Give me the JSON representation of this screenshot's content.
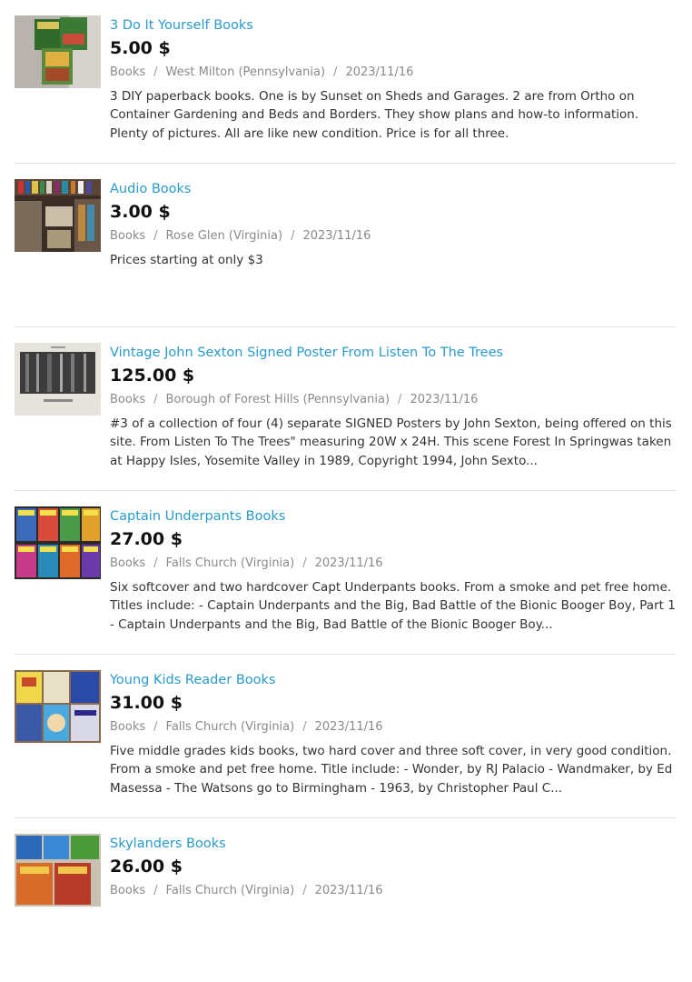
{
  "listings": [
    {
      "title": "3 Do It Yourself Books",
      "price": "5.00 $",
      "category": "Books",
      "separator": "/",
      "location": "West Milton (Pennsylvania)",
      "date": "2023/11/16",
      "description": "3 DIY paperback books. One is by Sunset on Sheds and Garages. 2 are from Ortho on Container Gardening and Beds and Borders. They show plans and how-to information. Plenty of pictures. All are like new condition. Price is for all three."
    },
    {
      "title": "Audio Books",
      "price": "3.00 $",
      "category": "Books",
      "separator": "/",
      "location": "Rose Glen (Virginia)",
      "date": "2023/11/16",
      "description": "Prices starting at only $3"
    },
    {
      "title": "Vintage John Sexton Signed Poster From Listen To The Trees",
      "price": "125.00 $",
      "category": "Books",
      "separator": "/",
      "location": "Borough of Forest Hills (Pennsylvania)",
      "date": "2023/11/16",
      "description": "#3 of a collection of four (4) separate SIGNED Posters by John Sexton, being offered on this site. From Listen To The Trees\" measuring 20W x 24H. This scene Forest In Springwas taken at Happy Isles, Yosemite Valley in 1989, Copyright 1994, John Sexto..."
    },
    {
      "title": "Captain Underpants Books",
      "price": "27.00 $",
      "category": "Books",
      "separator": "/",
      "location": "Falls Church (Virginia)",
      "date": "2023/11/16",
      "description": "Six softcover and two hardcover Capt Underpants books. From a smoke and pet free home. Titles include: - Captain Underpants and the Big, Bad Battle of the Bionic Booger Boy, Part 1 - Captain Underpants and the Big, Bad Battle of the Bionic Booger Boy..."
    },
    {
      "title": "Young Kids Reader Books",
      "price": "31.00 $",
      "category": "Books",
      "separator": "/",
      "location": "Falls Church (Virginia)",
      "date": "2023/11/16",
      "description": "Five middle grades kids books, two hard cover and three soft cover, in very good condition. From a smoke and pet free home. Title include: - Wonder, by RJ Palacio - Wandmaker, by Ed Masessa - The Watsons go to Birmingham - 1963, by Christopher Paul C..."
    },
    {
      "title": "Skylanders Books",
      "price": "26.00 $",
      "category": "Books",
      "separator": "/",
      "location": "Falls Church (Virginia)",
      "date": "2023/11/16",
      "description": ""
    }
  ]
}
